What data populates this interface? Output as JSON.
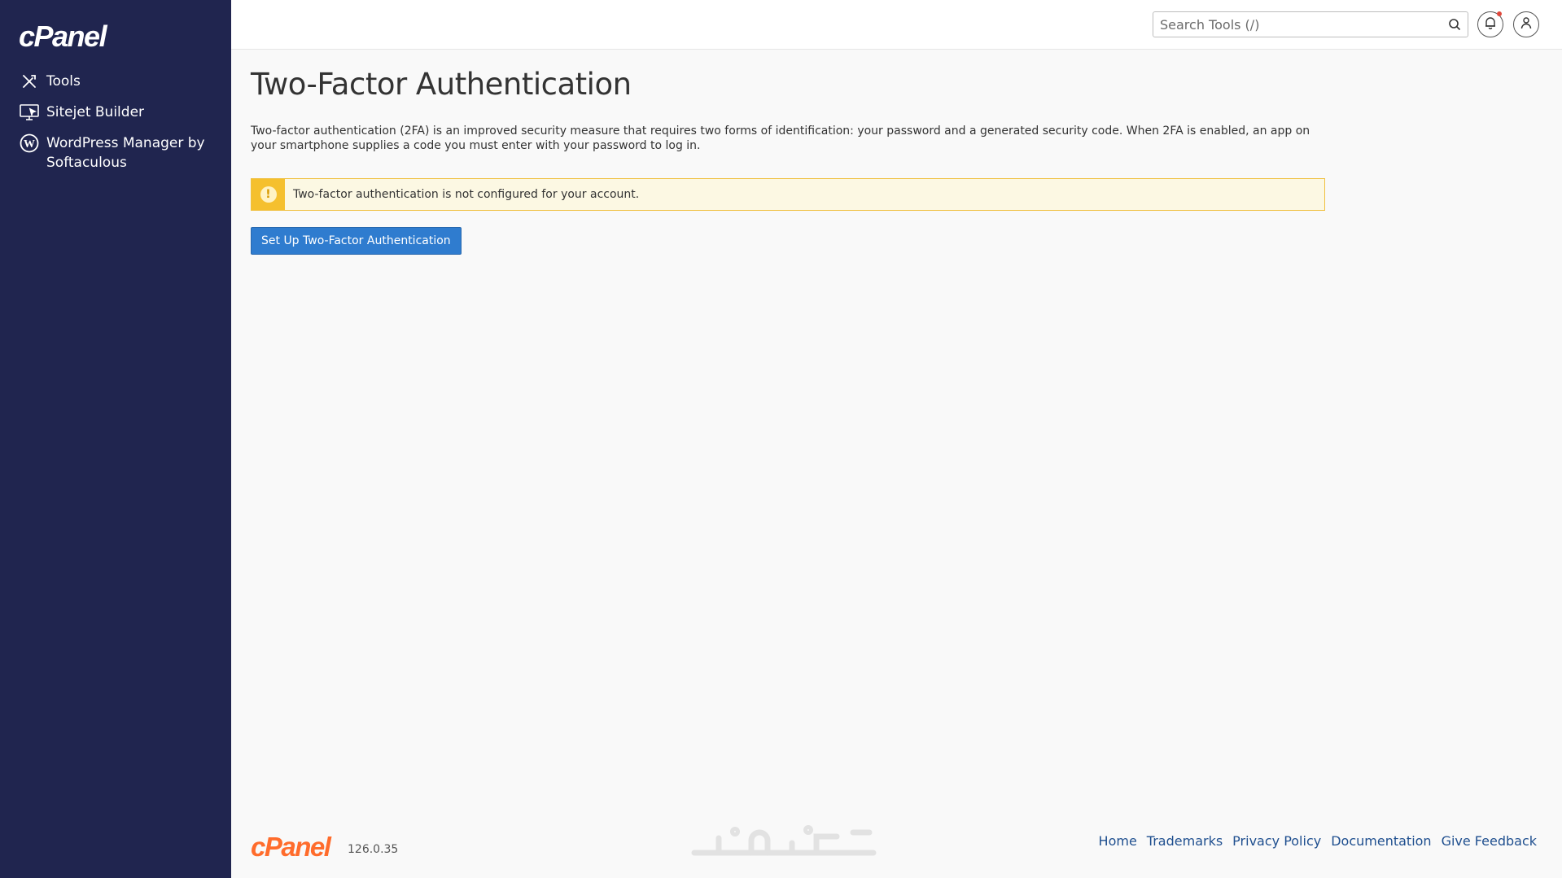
{
  "sidebar": {
    "logo_text": "cPanel",
    "items": [
      {
        "label": "Tools",
        "icon": "tools-icon"
      },
      {
        "label": "Sitejet Builder",
        "icon": "monitor-icon"
      },
      {
        "label": "WordPress Manager by Softaculous",
        "icon": "wordpress-icon"
      }
    ]
  },
  "header": {
    "search_placeholder": "Search Tools (/)"
  },
  "main": {
    "title": "Two-Factor Authentication",
    "description": "Two-factor authentication (2FA) is an improved security measure that requires two forms of identification: your password and a generated security code. When 2FA is enabled, an app on your smartphone supplies a code you must enter with your password to log in.",
    "alert_text": "Two-factor authentication is not configured for your account.",
    "alert_icon": "exclamation-icon",
    "setup_button": "Set Up Two-Factor Authentication"
  },
  "footer": {
    "logo_text": "cPanel",
    "version": "126.0.35",
    "links": [
      "Home",
      "Trademarks",
      "Privacy Policy",
      "Documentation",
      "Give Feedback"
    ]
  },
  "colors": {
    "sidebar_bg": "#20254f",
    "brand_orange": "#ff6c2c",
    "button_blue": "#2f7ccf",
    "alert_yellow": "#f5c02e",
    "notification_dot": "#e0483c"
  }
}
